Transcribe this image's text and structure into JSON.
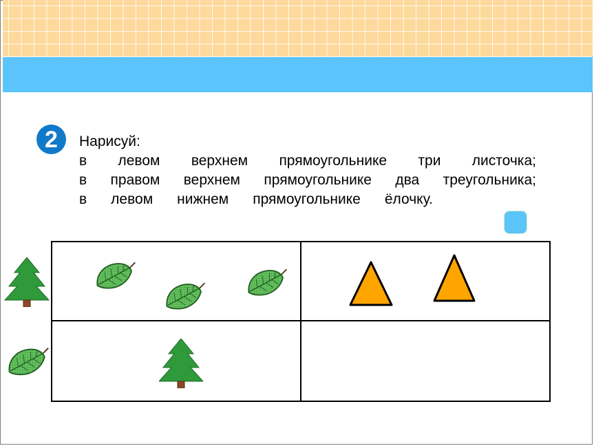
{
  "task": {
    "number": "2",
    "title": "Нарисуй:",
    "lines": [
      [
        "в",
        "левом",
        "верхнем",
        "прямоугольнике",
        "три",
        "листочка;"
      ],
      [
        "в",
        "правом",
        "верхнем",
        "прямоугольнике",
        "два",
        "треугольника;"
      ],
      [
        "в",
        "левом",
        "нижнем",
        "прямоугольнике",
        "ёлочку."
      ]
    ]
  },
  "colors": {
    "grid_band": "#fdd99b",
    "blue_band": "#5bc4fb",
    "badge": "#1279c9",
    "leaf": "#5cb85c",
    "tree": "#2e9e3e",
    "triangle": "#ffa500"
  },
  "icons": {
    "leaf": "leaf-icon",
    "tree": "fir-tree-icon",
    "triangle": "triangle-icon"
  }
}
